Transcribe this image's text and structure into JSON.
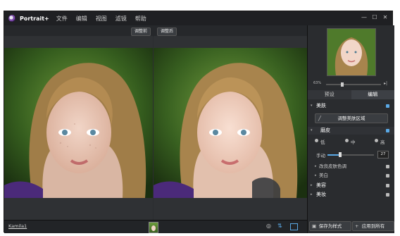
{
  "app": {
    "name": "Portrait+",
    "menu": [
      "文件",
      "编辑",
      "视图",
      "滤镜",
      "帮助"
    ]
  },
  "window_controls": [
    "—",
    "☐",
    "✕"
  ],
  "views": {
    "before_label": "调整前",
    "after_label": "调整后"
  },
  "bottom": {
    "filename": "Kamila1",
    "save_template": "保存为样式",
    "apply_all": "应用到所有"
  },
  "sidebar": {
    "zoom": {
      "value": "63%",
      "level": 0.3
    },
    "tabs": [
      "预设",
      "编辑"
    ],
    "section_beauty": "美肤",
    "adjust_skin_button": "调整美肤区域",
    "subsection_smooth": "磨皮",
    "smooth_options": [
      "低",
      "中",
      "高"
    ],
    "manual_label": "手动",
    "manual_value": "27",
    "manual_level": 0.27,
    "items": [
      {
        "label": "改良皮肤色调"
      },
      {
        "label": "美白"
      }
    ],
    "sections": [
      "美容",
      "美妆"
    ]
  },
  "colors": {
    "accent": "#5aa9e6",
    "bg": "#2b2d30"
  }
}
